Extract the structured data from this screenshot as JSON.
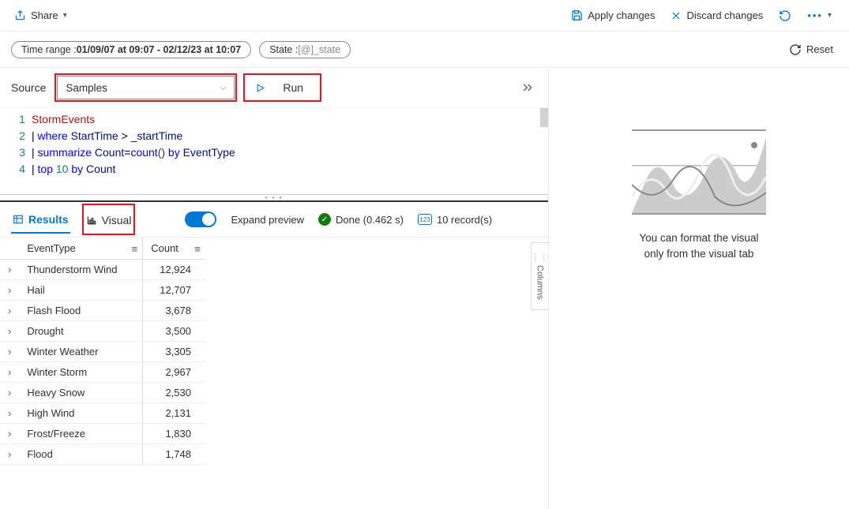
{
  "topbar": {
    "share": "Share",
    "apply_changes": "Apply changes",
    "discard_changes": "Discard changes"
  },
  "filters": {
    "time_range_label": "Time range : ",
    "time_range_value": "01/09/07 at 09:07 - 02/12/23 at 10:07",
    "state_label": "State : ",
    "state_value": "[@]_state",
    "reset": "Reset"
  },
  "source": {
    "label": "Source",
    "selected": "Samples",
    "run": "Run"
  },
  "editor": {
    "lines": [
      "StormEvents",
      "| where StartTime > _startTime",
      "| summarize Count=count() by EventType",
      "| top 10 by Count"
    ]
  },
  "tabs": {
    "results": "Results",
    "visual": "Visual",
    "expand_preview": "Expand preview",
    "done_label": "Done (0.462 s)",
    "record_count": "10 record(s)"
  },
  "columns_label": "Columns",
  "table": {
    "headers": {
      "event_type": "EventType",
      "count": "Count"
    },
    "rows": [
      {
        "event_type": "Thunderstorm Wind",
        "count": "12,924"
      },
      {
        "event_type": "Hail",
        "count": "12,707"
      },
      {
        "event_type": "Flash Flood",
        "count": "3,678"
      },
      {
        "event_type": "Drought",
        "count": "3,500"
      },
      {
        "event_type": "Winter Weather",
        "count": "3,305"
      },
      {
        "event_type": "Winter Storm",
        "count": "2,967"
      },
      {
        "event_type": "Heavy Snow",
        "count": "2,530"
      },
      {
        "event_type": "High Wind",
        "count": "2,131"
      },
      {
        "event_type": "Frost/Freeze",
        "count": "1,830"
      },
      {
        "event_type": "Flood",
        "count": "1,748"
      }
    ]
  },
  "right_pane": {
    "info_line1": "You can format the visual",
    "info_line2": "only from the visual tab"
  }
}
